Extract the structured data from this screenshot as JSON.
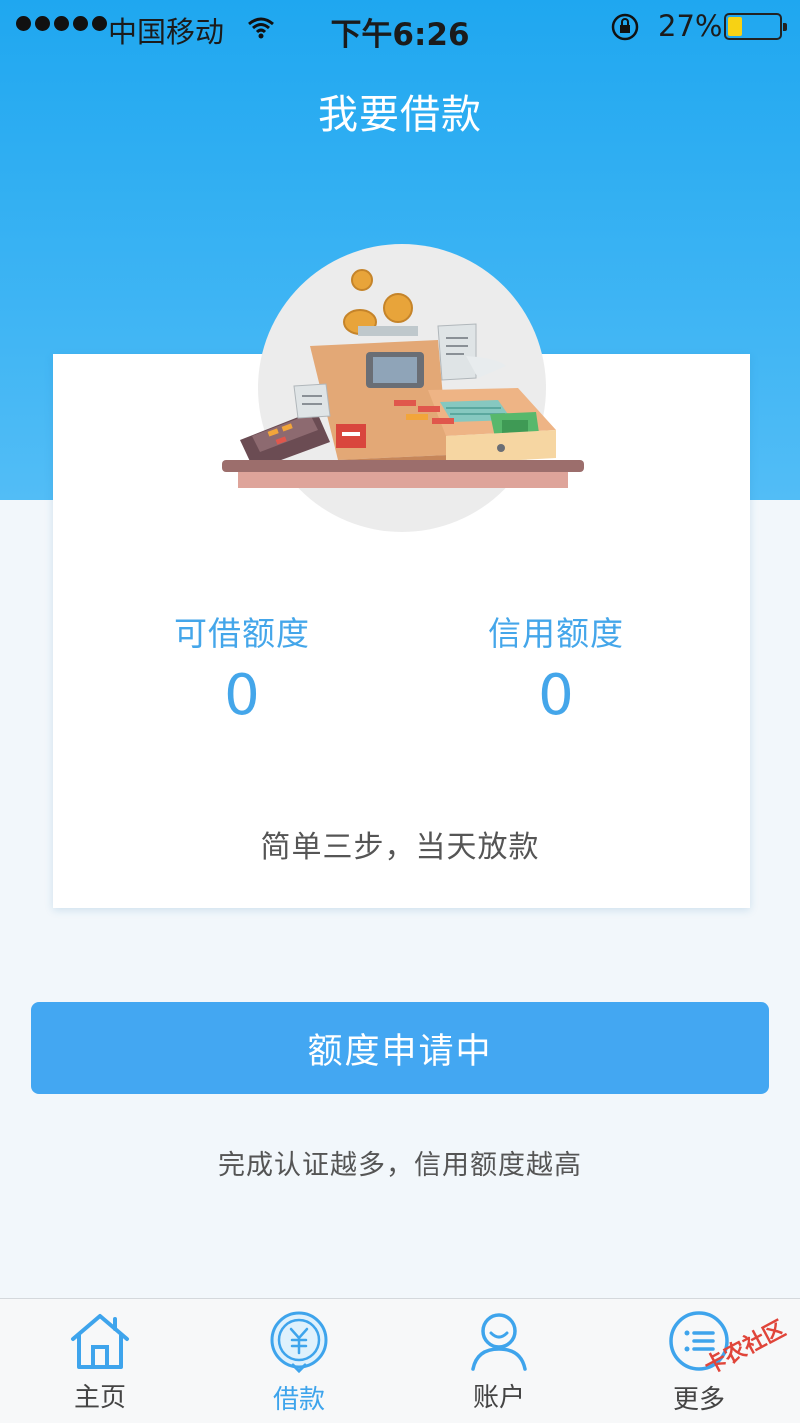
{
  "status_bar": {
    "carrier": "中国移动",
    "time": "下午6:26",
    "battery_percent": "27%",
    "battery_level": 0.27
  },
  "header": {
    "title": "我要借款"
  },
  "card": {
    "available_limit": {
      "label": "可借额度",
      "value": "0"
    },
    "credit_limit": {
      "label": "信用额度",
      "value": "0"
    },
    "note": "简单三步，当天放款"
  },
  "apply_button": {
    "label": "额度申请中"
  },
  "hint": "完成认证越多，信用额度越高",
  "tab_bar": {
    "items": [
      {
        "label": "主页",
        "icon": "home-icon",
        "active": false
      },
      {
        "label": "借款",
        "icon": "yuan-icon",
        "active": true
      },
      {
        "label": "账户",
        "icon": "user-icon",
        "active": false
      },
      {
        "label": "更多",
        "icon": "list-icon",
        "active": false
      }
    ]
  },
  "watermark": "卡农社区",
  "colors": {
    "accent": "#43a7f2",
    "header_gradient_top": "#1fa7f0",
    "header_gradient_bottom": "#52bdf6",
    "stat_text": "#44a6ea"
  }
}
